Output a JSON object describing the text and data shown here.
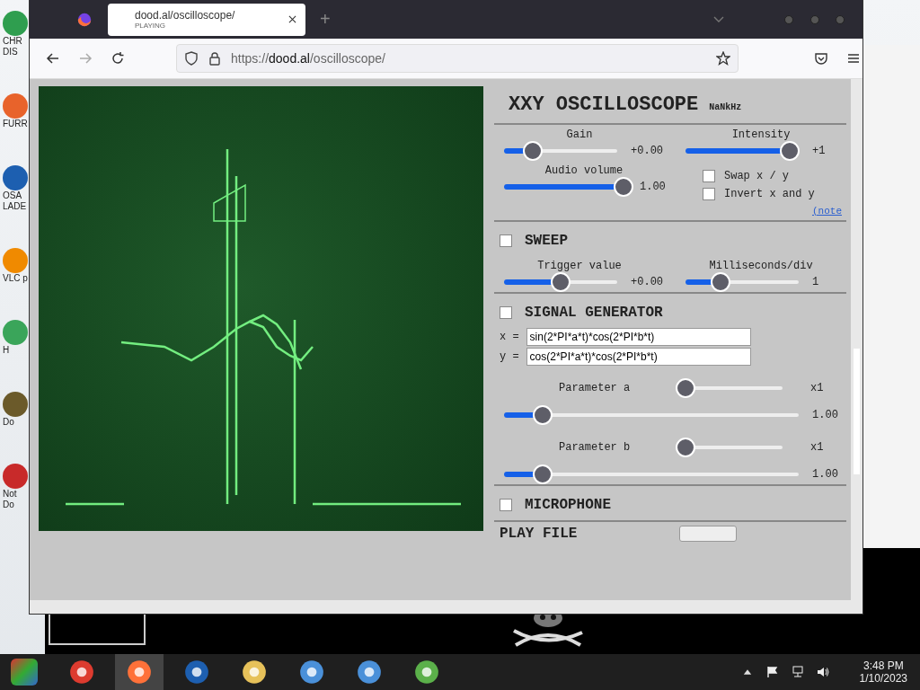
{
  "desktop_icons": [
    {
      "label": "CHR DIS",
      "color": "#2f9e4f"
    },
    {
      "label": "FURR",
      "color": "#e8632b"
    },
    {
      "label": "OSA LADE",
      "color": "#1d5fb0"
    },
    {
      "label": "VLC p",
      "color": "#f08a00"
    },
    {
      "label": "H",
      "color": "#3aa55a"
    },
    {
      "label": "Do",
      "color": "#6b5a2a"
    },
    {
      "label": "Not Do",
      "color": "#c82a2a"
    }
  ],
  "browser": {
    "tabs": [
      {
        "title": "dood.al/oscilloscope/",
        "subtitle": "PLAYING",
        "selected": true
      }
    ],
    "new_tab": "+",
    "address": {
      "scheme": "https://",
      "domain": "dood.al",
      "path": "/oscilloscope/"
    }
  },
  "page": {
    "title": "XXY OSCILLOSCOPE",
    "frequency": "NaNkHz",
    "main_sliders": [
      {
        "label": "Gain",
        "level": 0.25,
        "reading": "+0.00"
      },
      {
        "label": "Intensity",
        "level": 0.92,
        "reading": "+1"
      }
    ],
    "volume": {
      "label": "Audio volume",
      "level": 0.98,
      "reading": "1.00"
    },
    "options": [
      {
        "label": "Swap x / y",
        "checked": false
      },
      {
        "label": "Invert x and y",
        "checked": false
      }
    ],
    "note_link": "(note",
    "sweep": {
      "title": "SWEEP",
      "checked": false,
      "sliders": [
        {
          "label": "Trigger value",
          "level": 0.5,
          "reading": "+0.00"
        },
        {
          "label": "Milliseconds/div",
          "level": 0.31,
          "reading": "1"
        }
      ]
    },
    "signal_generator": {
      "title": "SIGNAL GENERATOR",
      "checked": false,
      "formulas": [
        {
          "label": "x =",
          "value": "sin(2*PI*a*t)*cos(2*PI*b*t)"
        },
        {
          "label": "y =",
          "value": "cos(2*PI*a*t)*cos(2*PI*b*t)"
        }
      ],
      "parameters": [
        {
          "label": "Parameter a",
          "multiplier": {
            "level": 0,
            "reading": "x1"
          },
          "level": 0.13,
          "reading": "1.00"
        },
        {
          "label": "Parameter b",
          "multiplier": {
            "level": 0,
            "reading": "x1"
          },
          "level": 0.13,
          "reading": "1.00"
        }
      ]
    },
    "microphone": {
      "title": "MICROPHONE",
      "checked": false
    },
    "play_file": {
      "title": "PLAY FILE"
    }
  },
  "taskbar": {
    "time": "3:48 PM",
    "date": "1/10/2023"
  }
}
